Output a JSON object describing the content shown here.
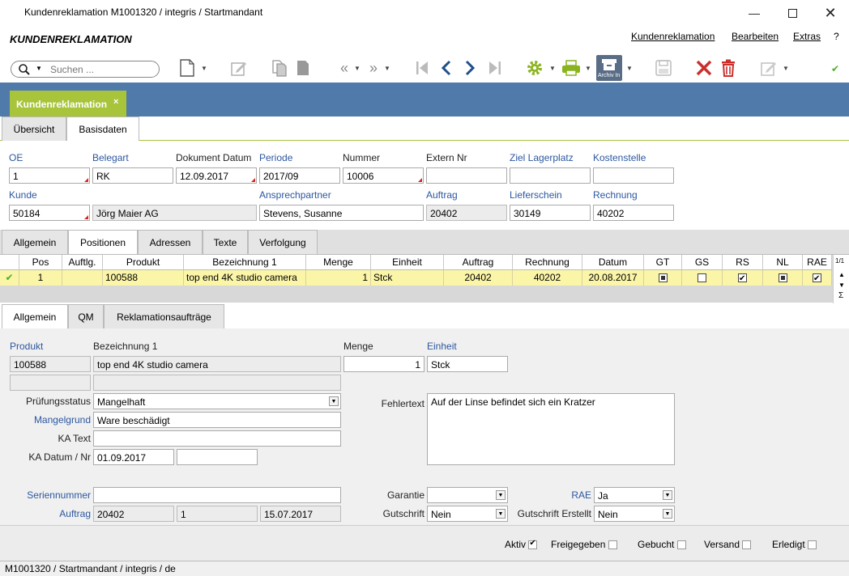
{
  "window": {
    "title": "Kundenreklamation M1001320 / integris / Startmandant"
  },
  "app": {
    "title": "KUNDENREKLAMATION",
    "menu": [
      "Kundenreklamation",
      "Bearbeiten",
      "Extras",
      "?"
    ]
  },
  "search": {
    "placeholder": "Suchen ..."
  },
  "toolbar": {
    "archive_label": "Archiv In"
  },
  "main_tab": {
    "label": "Kundenreklamation",
    "close": "×"
  },
  "top_tabs": [
    "Übersicht",
    "Basisdaten"
  ],
  "header_form": {
    "oe": {
      "label": "OE",
      "value": "1"
    },
    "belegart": {
      "label": "Belegart",
      "value": "RK"
    },
    "dokument_datum": {
      "label": "Dokument Datum",
      "value": "12.09.2017"
    },
    "periode": {
      "label": "Periode",
      "value": "2017/09"
    },
    "nummer": {
      "label": "Nummer",
      "value": "10006"
    },
    "extern_nr": {
      "label": "Extern Nr",
      "value": ""
    },
    "ziel_lagerplatz": {
      "label": "Ziel Lagerplatz",
      "value": ""
    },
    "kostenstelle": {
      "label": "Kostenstelle",
      "value": ""
    },
    "kunde": {
      "label": "Kunde",
      "value": "50184",
      "name": "Jörg Maier AG"
    },
    "ansprechpartner": {
      "label": "Ansprechpartner",
      "value": "Stevens, Susanne"
    },
    "auftrag": {
      "label": "Auftrag",
      "value": "20402"
    },
    "lieferschein": {
      "label": "Lieferschein",
      "value": "30149"
    },
    "rechnung": {
      "label": "Rechnung",
      "value": "40202"
    }
  },
  "section_tabs": [
    "Allgemein",
    "Positionen",
    "Adressen",
    "Texte",
    "Verfolgung"
  ],
  "grid": {
    "columns": [
      "Pos",
      "Auftlg.",
      "Produkt",
      "Bezeichnung 1",
      "Menge",
      "Einheit",
      "Auftrag",
      "Rechnung",
      "Datum",
      "GT",
      "GS",
      "RS",
      "NL",
      "RAE"
    ],
    "page": "1/1",
    "rows": [
      {
        "pos": "1",
        "auftlg": "",
        "produkt": "100588",
        "bezeichnung": "top end 4K studio camera",
        "menge": "1",
        "einheit": "Stck",
        "auftrag": "20402",
        "rechnung": "40202",
        "datum": "20.08.2017",
        "gt": "filled",
        "gs": "empty",
        "rs": "checked",
        "nl": "filled",
        "rae": "checked"
      }
    ]
  },
  "detail_tabs": [
    "Allgemein",
    "QM",
    "Reklamationsaufträge"
  ],
  "detail": {
    "produkt": {
      "label": "Produkt",
      "value": "100588"
    },
    "bezeichnung": {
      "label": "Bezeichnung 1",
      "value": "top end 4K studio camera"
    },
    "menge": {
      "label": "Menge",
      "value": "1"
    },
    "einheit": {
      "label": "Einheit",
      "value": "Stck"
    },
    "pruefungsstatus": {
      "label": "Prüfungsstatus",
      "value": "Mangelhaft"
    },
    "mangelgrund": {
      "label": "Mangelgrund",
      "value": "Ware beschädigt"
    },
    "ka_text": {
      "label": "KA Text",
      "value": ""
    },
    "ka_datum": {
      "label": "KA Datum / Nr",
      "value": "01.09.2017",
      "nr": ""
    },
    "fehlertext": {
      "label": "Fehlertext",
      "value": "Auf der Linse befindet sich ein Kratzer"
    },
    "seriennummer": {
      "label": "Seriennummer",
      "value": ""
    },
    "auftrag": {
      "label": "Auftrag",
      "value": "20402",
      "pos": "1",
      "datum": "15.07.2017"
    },
    "garantie": {
      "label": "Garantie",
      "value": ""
    },
    "gutschrift": {
      "label": "Gutschrift",
      "value": "Nein"
    },
    "rae": {
      "label": "RAE",
      "value": "Ja"
    },
    "gutschrift_erstellt": {
      "label": "Gutschrift Erstellt",
      "value": "Nein"
    }
  },
  "footer": {
    "aktiv": "Aktiv",
    "freigegeben": "Freigegeben",
    "gebucht": "Gebucht",
    "versand": "Versand",
    "erledigt": "Erledigt"
  },
  "status": "M1001320 / Startmandant / integris / de",
  "colors": {
    "accent": "#a8c43a",
    "tabbar": "#4f7aa9",
    "row_highlight": "#fbf5a8"
  }
}
